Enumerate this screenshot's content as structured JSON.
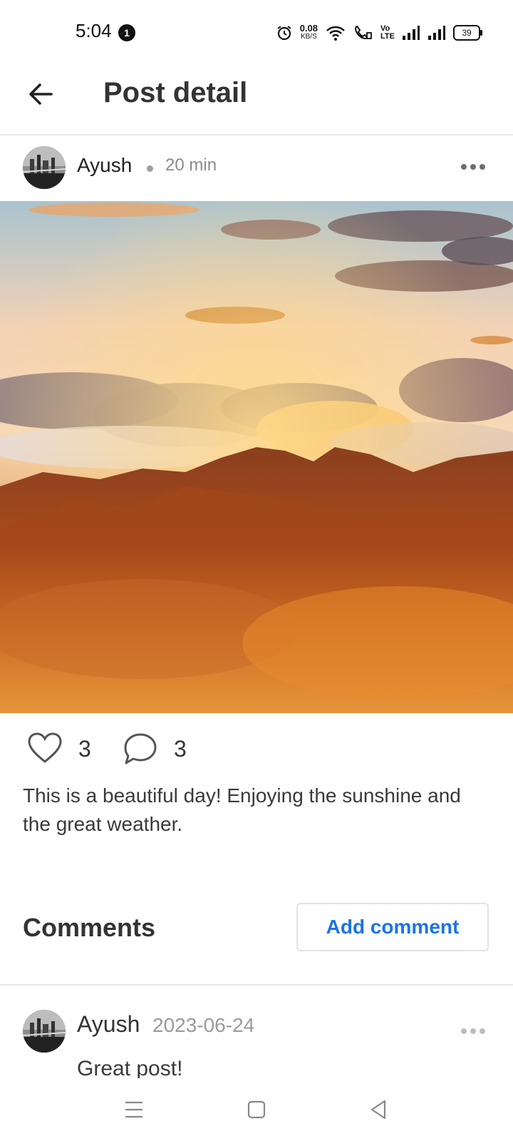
{
  "status_bar": {
    "time": "5:04",
    "notification_count": "1",
    "net_speed_value": "0.08",
    "net_speed_unit": "KB/S",
    "volte_label_top": "Vo",
    "volte_label_bottom": "LTE",
    "battery_level": "39",
    "icons": [
      "alarm-icon",
      "wifi-icon",
      "call-icon",
      "volte-icon",
      "signal-icon",
      "signal-icon",
      "battery-icon"
    ]
  },
  "header": {
    "title": "Post detail",
    "back_icon": "arrow-left-icon"
  },
  "post": {
    "author": "Ayush",
    "time": "20 min",
    "image_description_icon": "landscape-photo",
    "likes": "3",
    "comments": "3",
    "caption": "This is a beautiful day! Enjoying the sunshine and the great weather."
  },
  "comments_section": {
    "title": "Comments",
    "add_button_label": "Add comment",
    "items": [
      {
        "author": "Ayush",
        "date": "2023-06-24",
        "text": "Great post!"
      }
    ]
  },
  "colors": {
    "accent": "#1a73e8",
    "text_primary": "#333333",
    "text_secondary": "#8b8b8b",
    "divider": "#e6e6e6"
  },
  "nav_bar": {
    "icons": [
      "menu-icon",
      "home-square-icon",
      "back-triangle-icon"
    ]
  }
}
